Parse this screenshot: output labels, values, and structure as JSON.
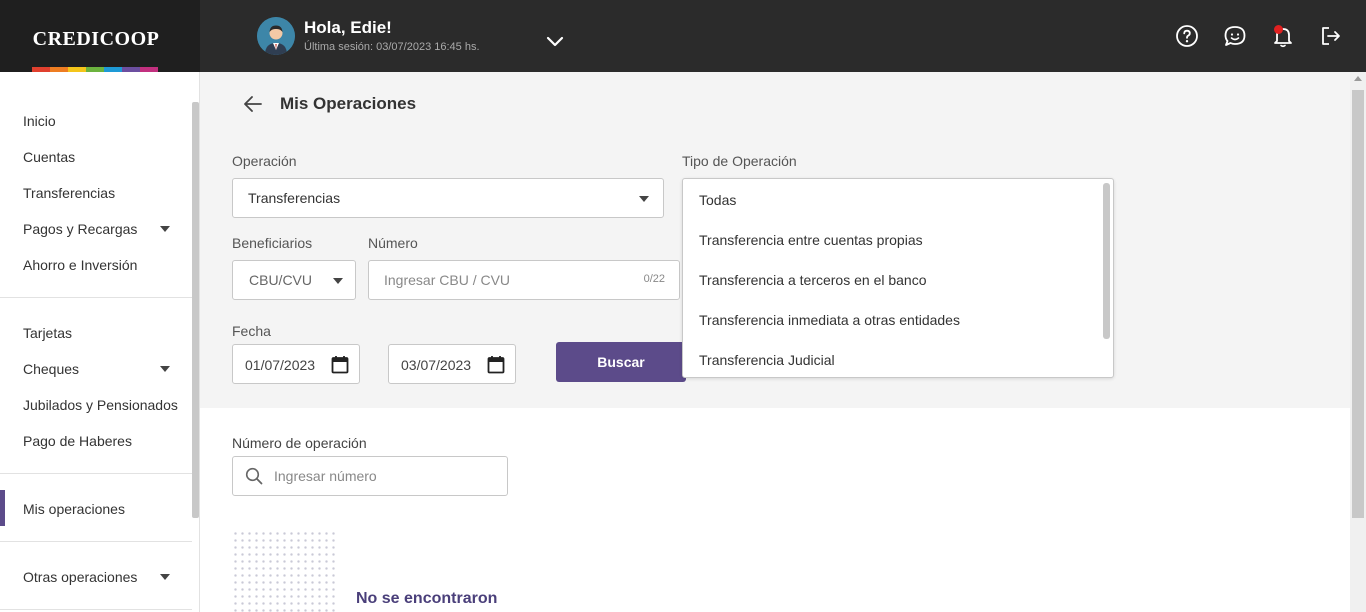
{
  "header": {
    "logo": "CREDICOOP",
    "rainbow_colors": [
      "#e0402e",
      "#ee7d22",
      "#f4c51a",
      "#6cb33f",
      "#1e9ad6",
      "#6c4fa0",
      "#c2307f"
    ],
    "greeting": "Hola, Edie!",
    "last_session": "Última sesión: 03/07/2023 16:45 hs.",
    "icons": [
      "help-icon",
      "chat-icon",
      "bell-icon",
      "logout-icon"
    ],
    "notification_color": "#e02020"
  },
  "sidebar": {
    "groups": [
      [
        {
          "label": "Inicio",
          "expandable": false
        },
        {
          "label": "Cuentas",
          "expandable": false
        },
        {
          "label": "Transferencias",
          "expandable": false
        },
        {
          "label": "Pagos y Recargas",
          "expandable": true
        },
        {
          "label": "Ahorro e Inversión",
          "expandable": false
        }
      ],
      [
        {
          "label": "Tarjetas",
          "expandable": false
        },
        {
          "label": "Cheques",
          "expandable": true
        },
        {
          "label": "Jubilados y Pensionados",
          "expandable": false
        },
        {
          "label": "Pago de Haberes",
          "expandable": false
        }
      ],
      [
        {
          "label": "Mis operaciones",
          "expandable": false,
          "active": true
        }
      ],
      [
        {
          "label": "Otras operaciones",
          "expandable": true
        }
      ]
    ],
    "active_color": "#5c4b8a"
  },
  "main": {
    "title": "Mis Operaciones",
    "operacion": {
      "label": "Operación",
      "value": "Transferencias"
    },
    "tipo_operacion": {
      "label": "Tipo de Operación",
      "options": [
        "Todas",
        "Transferencia entre cuentas propias",
        "Transferencia a terceros en el banco",
        "Transferencia inmediata a otras entidades",
        "Transferencia Judicial"
      ]
    },
    "beneficiarios": {
      "label": "Beneficiarios",
      "value": "CBU/CVU"
    },
    "numero": {
      "label": "Número",
      "placeholder": "Ingresar CBU / CVU",
      "counter": "0/22"
    },
    "fecha": {
      "label": "Fecha",
      "from": "01/07/2023",
      "to": "03/07/2023"
    },
    "buscar_label": "Buscar",
    "numero_operacion": {
      "label": "Número de operación",
      "placeholder": "Ingresar número"
    },
    "empty_message": "No se encontraron"
  }
}
